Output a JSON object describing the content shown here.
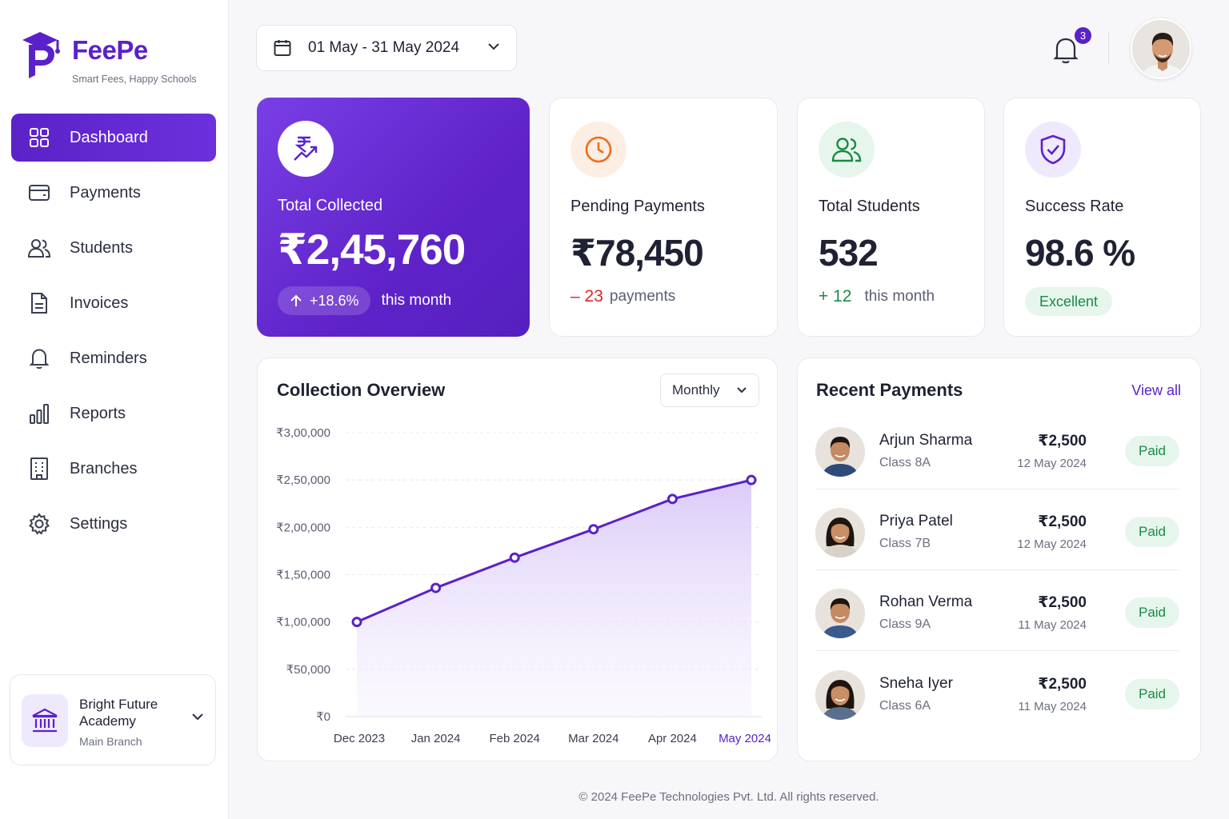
{
  "app": {
    "brand": "FeePe",
    "tagline": "Smart Fees, Happy Schools"
  },
  "sidebar": {
    "items": [
      {
        "label": "Dashboard",
        "icon": "dashboard-icon",
        "active": true
      },
      {
        "label": "Payments",
        "icon": "wallet-icon"
      },
      {
        "label": "Students",
        "icon": "users-icon"
      },
      {
        "label": "Invoices",
        "icon": "document-icon"
      },
      {
        "label": "Reminders",
        "icon": "bell-icon"
      },
      {
        "label": "Reports",
        "icon": "bar-chart-icon"
      },
      {
        "label": "Branches",
        "icon": "building-icon"
      },
      {
        "label": "Settings",
        "icon": "gear-icon"
      }
    ],
    "branch": {
      "name": "Bright Future Academy",
      "sub": "Main Branch",
      "icon": "bank-icon"
    }
  },
  "header": {
    "date_range": "01 May - 31 May 2024",
    "notification_count": "3"
  },
  "stats": {
    "total_collected": {
      "label": "Total Collected",
      "value": "₹2,45,760",
      "change": "+18.6%",
      "suffix": "this month"
    },
    "pending": {
      "label": "Pending Payments",
      "value": "₹78,450",
      "delta": "– 23",
      "suffix": "payments"
    },
    "students": {
      "label": "Total Students",
      "value": "532",
      "delta": "+ 12",
      "suffix": "this month"
    },
    "success": {
      "label": "Success Rate",
      "value": "98.6 %",
      "badge": "Excellent"
    }
  },
  "chart": {
    "title": "Collection Overview",
    "period": "Monthly"
  },
  "chart_data": {
    "type": "area",
    "categories": [
      "Dec 2023",
      "Jan 2024",
      "Feb 2024",
      "Mar 2024",
      "Apr 2024",
      "May 2024"
    ],
    "series": [
      {
        "values": [
          100000,
          136000,
          168000,
          198000,
          230000,
          250000
        ]
      }
    ],
    "y_ticks": [
      "₹0",
      "₹50,000",
      "₹1,00,000",
      "₹1,50,000",
      "₹2,00,000",
      "₹2,50,000",
      "₹3,00,000"
    ],
    "ylim": [
      0,
      300000
    ],
    "highlight_category": "May 2024",
    "grid": true,
    "colors": {
      "line": "#5b21c9",
      "fill": "#e9e0fb",
      "highlight": "#5b21c9"
    }
  },
  "recent": {
    "title": "Recent Payments",
    "view_all": "View all",
    "items": [
      {
        "name": "Arjun Sharma",
        "class": "Class 8A",
        "amount": "₹2,500",
        "date": "12 May 2024",
        "status": "Paid"
      },
      {
        "name": "Priya Patel",
        "class": "Class 7B",
        "amount": "₹2,500",
        "date": "12 May 2024",
        "status": "Paid"
      },
      {
        "name": "Rohan Verma",
        "class": "Class 9A",
        "amount": "₹2,500",
        "date": "11 May 2024",
        "status": "Paid"
      },
      {
        "name": "Sneha Iyer",
        "class": "Class 6A",
        "amount": "₹2,500",
        "date": "11 May 2024",
        "status": "Paid"
      }
    ]
  },
  "footer": "© 2024 FeePe Technologies Pvt. Ltd. All rights reserved.",
  "colors": {
    "brand": "#5b21c9",
    "success": "#1a8a45",
    "danger": "#e02424",
    "warning": "#ef6c1a"
  }
}
